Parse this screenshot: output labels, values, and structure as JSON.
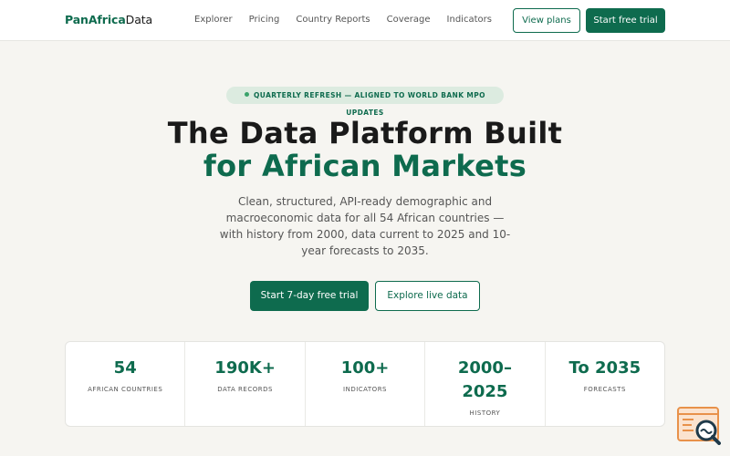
{
  "header": {
    "logo_brand": "PanAfrica",
    "logo_rest": "Data",
    "nav": [
      "Explorer",
      "Pricing",
      "Country Reports",
      "Coverage",
      "Indicators"
    ],
    "view_plans": "View plans",
    "start_trial": "Start free trial"
  },
  "hero": {
    "badge": "QUARTERLY REFRESH — ALIGNED TO WORLD BANK MPO UPDATES",
    "title_line1": "The Data Platform Built",
    "title_line2": "for African Markets",
    "subtitle": "Clean, structured, API-ready demographic and macroeconomic data for all 54 African countries — with history from 2000, data current to 2025 and 10-year forecasts to 2035.",
    "cta_primary": "Start 7-day free trial",
    "cta_secondary": "Explore live data"
  },
  "stats": [
    {
      "value": "54",
      "label": "AFRICAN COUNTRIES"
    },
    {
      "value": "190K+",
      "label": "DATA RECORDS"
    },
    {
      "value": "100+",
      "label": "INDICATORS"
    },
    {
      "value": "2000–2025",
      "label": "HISTORY"
    },
    {
      "value": "To 2035",
      "label": "FORECASTS"
    }
  ],
  "colors": {
    "brand": "#0e6b4e",
    "background": "#f6f5f1",
    "badge_bg": "#dcebe0",
    "widget_orange": "#e8914a"
  },
  "icons": {
    "badge": "status-dot-icon",
    "widget": "chat-search-icon"
  }
}
